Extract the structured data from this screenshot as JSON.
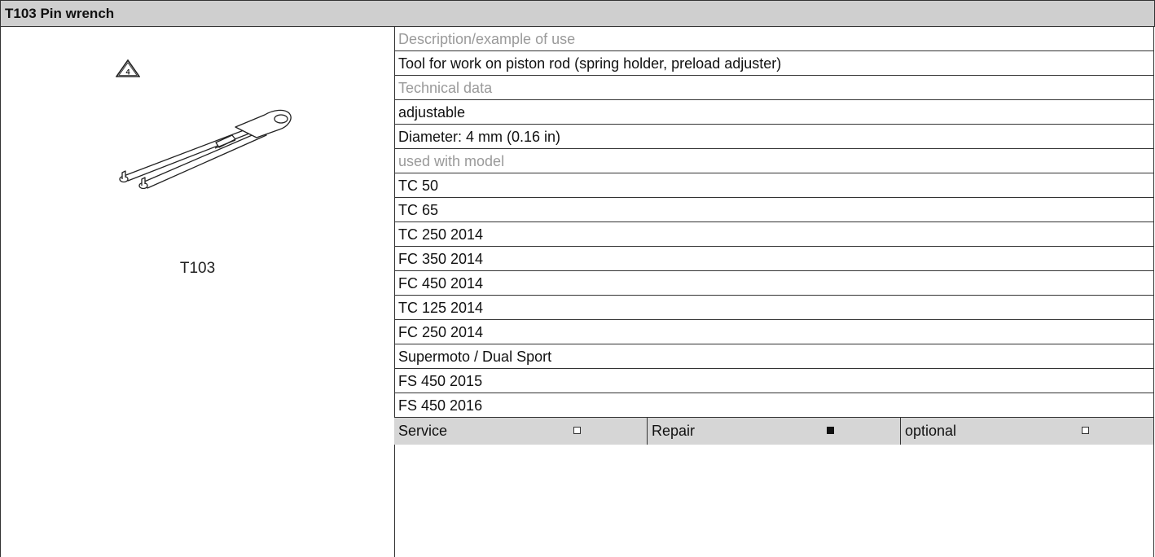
{
  "header": {
    "title": "T103 Pin wrench"
  },
  "tool": {
    "label": "T103",
    "warning_number": "4"
  },
  "rows": [
    {
      "text": "Description/example of use",
      "style": "label"
    },
    {
      "text": "Tool for work on piston rod (spring holder, preload adjuster)",
      "style": "value"
    },
    {
      "text": "Technical data",
      "style": "label"
    },
    {
      "text": "adjustable",
      "style": "value"
    },
    {
      "text": "Diameter: 4 mm (0.16 in)",
      "style": "value"
    },
    {
      "text": "used with model",
      "style": "label"
    },
    {
      "text": "TC 50",
      "style": "value"
    },
    {
      "text": "TC 65",
      "style": "value"
    },
    {
      "text": "TC 250 2014",
      "style": "value"
    },
    {
      "text": "FC 350 2014",
      "style": "value"
    },
    {
      "text": "FC 450 2014",
      "style": "value"
    },
    {
      "text": "TC 125 2014",
      "style": "value"
    },
    {
      "text": "FC 250 2014",
      "style": "value"
    },
    {
      "text": "Supermoto / Dual Sport",
      "style": "value"
    },
    {
      "text": "FS 450 2015",
      "style": "value"
    },
    {
      "text": "FS 450 2016",
      "style": "value"
    }
  ],
  "footer": {
    "service": {
      "label": "Service",
      "checked": false
    },
    "repair": {
      "label": "Repair",
      "checked": true
    },
    "optional": {
      "label": "optional",
      "checked": false
    }
  }
}
